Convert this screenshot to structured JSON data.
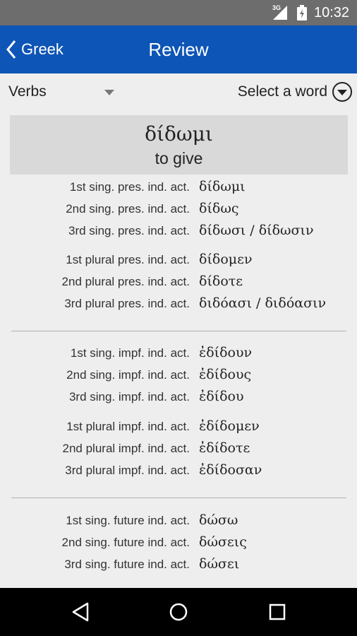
{
  "status_bar": {
    "network": "3G",
    "time": "10:32",
    "icons": [
      "signal-icon",
      "battery-icon"
    ]
  },
  "app_bar": {
    "back_label": "Greek",
    "title": "Review",
    "color": "#0d55b6"
  },
  "selectors": {
    "category": "Verbs",
    "word_placeholder": "Select a word"
  },
  "word": {
    "greek": "δίδωμι",
    "english": "to give"
  },
  "groups": [
    {
      "rows": [
        {
          "label": "1st sing. pres. ind. act.",
          "form": "δίδωμι"
        },
        {
          "label": "2nd sing. pres. ind. act.",
          "form": "δίδως"
        },
        {
          "label": "3rd sing. pres. ind. act.",
          "form": "δίδωσι / δίδωσιν"
        },
        {
          "label": "1st plural pres. ind. act.",
          "form": "δίδομεν"
        },
        {
          "label": "2nd plural pres. ind. act.",
          "form": "δίδοτε"
        },
        {
          "label": "3rd plural pres. ind. act.",
          "form": "διδόασι / διδόασιν"
        }
      ]
    },
    {
      "rows": [
        {
          "label": "1st sing. impf. ind. act.",
          "form": "ἐδίδουν"
        },
        {
          "label": "2nd sing. impf. ind. act.",
          "form": "ἐδίδους"
        },
        {
          "label": "3rd sing. impf. ind. act.",
          "form": "ἐδίδου"
        },
        {
          "label": "1st plural impf. ind. act.",
          "form": "ἐδίδομεν"
        },
        {
          "label": "2nd plural impf. ind. act.",
          "form": "ἐδίδοτε"
        },
        {
          "label": "3rd plural impf. ind. act.",
          "form": "ἐδίδοσαν"
        }
      ]
    },
    {
      "rows": [
        {
          "label": "1st sing. future ind. act.",
          "form": "δώσω"
        },
        {
          "label": "2nd sing. future ind. act.",
          "form": "δώσεις"
        },
        {
          "label": "3rd sing. future ind. act.",
          "form": "δώσει"
        }
      ]
    }
  ],
  "nav_bar": {
    "buttons": [
      "back-nav-icon",
      "home-nav-icon",
      "recents-nav-icon"
    ]
  }
}
